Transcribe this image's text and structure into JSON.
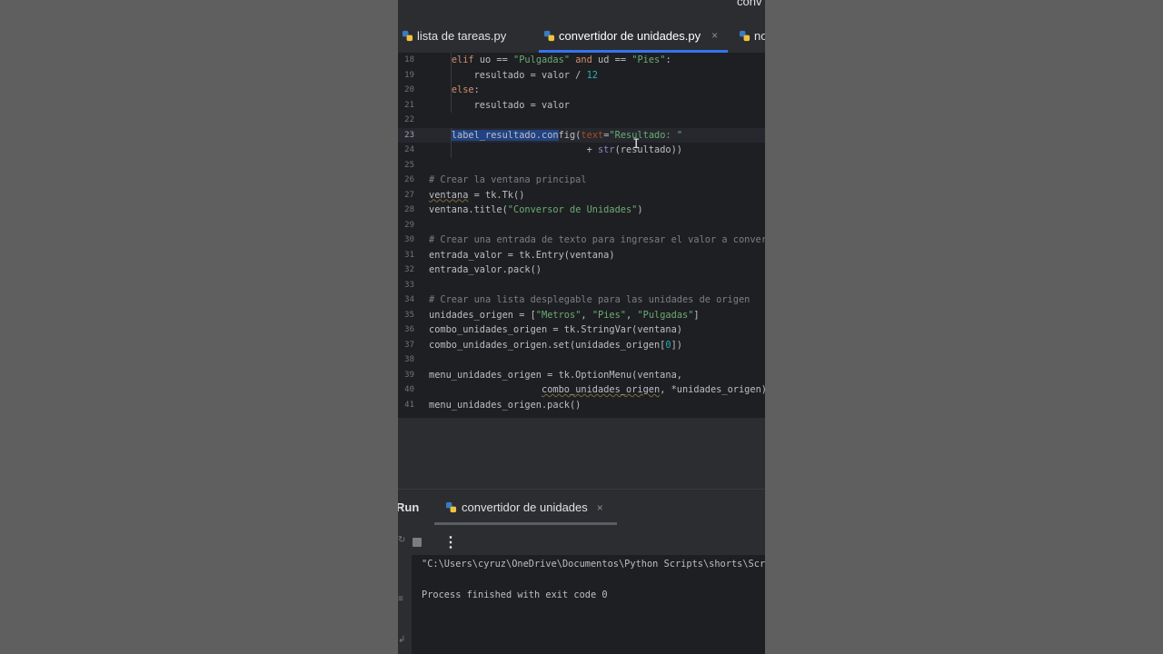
{
  "top_strip": {
    "label": "conv"
  },
  "tabs": [
    {
      "label": "lista de tareas.py"
    },
    {
      "label": "convertidor de unidades.py",
      "active": true,
      "close": "×"
    },
    {
      "label": "no"
    }
  ],
  "editor": {
    "lines": [
      {
        "n": "18",
        "t": [
          [
            "    ",
            ""
          ],
          [
            "elif",
            "kw"
          ],
          [
            " uo == ",
            ""
          ],
          [
            "\"Pulgadas\"",
            "str"
          ],
          [
            " ",
            ""
          ],
          [
            "and",
            "kw"
          ],
          [
            " ud == ",
            ""
          ],
          [
            "\"Pies\"",
            "str"
          ],
          [
            ":",
            ""
          ]
        ]
      },
      {
        "n": "19",
        "t": [
          [
            "        resultado = valor / ",
            ""
          ],
          [
            "12",
            "num"
          ]
        ]
      },
      {
        "n": "20",
        "t": [
          [
            "    ",
            ""
          ],
          [
            "else",
            "kw"
          ],
          [
            ":",
            ""
          ]
        ]
      },
      {
        "n": "21",
        "t": [
          [
            "        resultado = valor",
            ""
          ]
        ]
      },
      {
        "n": "22",
        "t": []
      },
      {
        "n": "23",
        "current": true,
        "t": [
          [
            "    ",
            ""
          ],
          [
            "label_resultado.con",
            "sel"
          ],
          [
            "fig(",
            ""
          ],
          [
            "text",
            "param"
          ],
          [
            "=",
            ""
          ],
          [
            "\"Resultado: \"",
            "str"
          ]
        ]
      },
      {
        "n": "24",
        "t": [
          [
            "                            + ",
            ""
          ],
          [
            "str",
            "kw2"
          ],
          [
            "(resultado))",
            ""
          ]
        ]
      },
      {
        "n": "25",
        "t": []
      },
      {
        "n": "26",
        "t": [
          [
            "# Crear la ventana principal",
            "cmt"
          ]
        ]
      },
      {
        "n": "27",
        "t": [
          [
            "ventana",
            "warn"
          ],
          [
            " = tk.Tk()",
            ""
          ]
        ]
      },
      {
        "n": "28",
        "t": [
          [
            "ventana.title(",
            ""
          ],
          [
            "\"Conversor de Unidades\"",
            "str"
          ],
          [
            ")",
            ""
          ]
        ]
      },
      {
        "n": "29",
        "t": []
      },
      {
        "n": "30",
        "t": [
          [
            "# Crear una entrada de texto para ingresar el valor a converti",
            "cmt"
          ]
        ]
      },
      {
        "n": "31",
        "t": [
          [
            "entrada_valor = tk.Entry(ventana)",
            ""
          ]
        ]
      },
      {
        "n": "32",
        "t": [
          [
            "entrada_valor.pack()",
            ""
          ]
        ]
      },
      {
        "n": "33",
        "t": []
      },
      {
        "n": "34",
        "t": [
          [
            "# Crear una lista desplegable para las unidades de origen",
            "cmt"
          ]
        ]
      },
      {
        "n": "35",
        "t": [
          [
            "unidades_origen = [",
            ""
          ],
          [
            "\"Metros\"",
            "str"
          ],
          [
            ", ",
            ""
          ],
          [
            "\"Pies\"",
            "str"
          ],
          [
            ", ",
            ""
          ],
          [
            "\"Pulgadas\"",
            "str"
          ],
          [
            "]",
            ""
          ]
        ]
      },
      {
        "n": "36",
        "t": [
          [
            "combo_unidades_origen = tk.StringVar(ventana)",
            ""
          ]
        ]
      },
      {
        "n": "37",
        "t": [
          [
            "combo_unidades_origen.set(unidades_origen[",
            ""
          ],
          [
            "0",
            "num"
          ],
          [
            "])",
            ""
          ]
        ]
      },
      {
        "n": "38",
        "t": []
      },
      {
        "n": "39",
        "t": [
          [
            "menu_unidades_origen = tk.OptionMenu(ventana,",
            ""
          ]
        ]
      },
      {
        "n": "40",
        "t": [
          [
            "                    ",
            ""
          ],
          [
            "combo_unidades_origen",
            "warn"
          ],
          [
            ", *unidades_origen)",
            ""
          ]
        ]
      },
      {
        "n": "41",
        "t": [
          [
            "menu_unidades_origen.pack()",
            ""
          ]
        ]
      }
    ]
  },
  "run_panel": {
    "title": "Run",
    "tab_label": "convertidor de unidades",
    "tab_close": "×",
    "more": "⋮",
    "console": [
      "\"C:\\Users\\cyruz\\OneDrive\\Documentos\\Python Scripts\\shorts\\Scri",
      "",
      "Process finished with exit code 0"
    ]
  },
  "colors": {
    "accent": "#3574f0",
    "editor_bg": "#1e1f22",
    "panel_bg": "#2b2d30",
    "page_bg": "#5f5f5f"
  }
}
